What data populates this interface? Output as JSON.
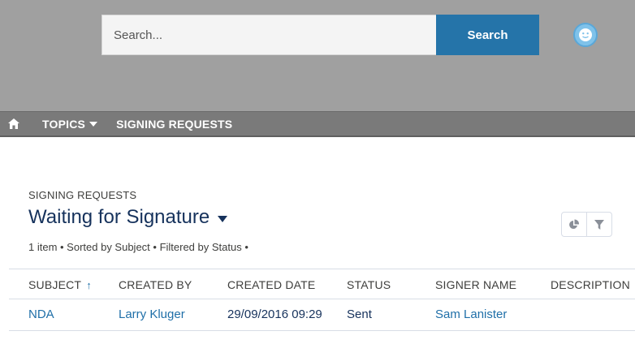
{
  "search": {
    "placeholder": "Search...",
    "button_label": "Search"
  },
  "nav": {
    "topics_label": "TOPICS",
    "signing_label": "SIGNING REQUESTS"
  },
  "list": {
    "object_label": "SIGNING REQUESTS",
    "title": "Waiting for Signature",
    "meta": "1 item • Sorted by Subject • Filtered by Status •"
  },
  "table": {
    "columns": [
      "SUBJECT",
      "CREATED BY",
      "CREATED DATE",
      "STATUS",
      "SIGNER NAME",
      "DESCRIPTION"
    ],
    "sort_indicator": "↑",
    "rows": [
      {
        "subject": "NDA",
        "created_by": "Larry Kluger",
        "created_date": "29/09/2016 09:29",
        "status": "Sent",
        "signer_name": "Sam Lanister",
        "description": ""
      }
    ]
  },
  "icons": {
    "home": "home-icon",
    "avatar": "smiley-avatar-icon",
    "chart": "pie-chart-icon",
    "filter": "filter-icon"
  },
  "colors": {
    "header_bg": "#a0a0a0",
    "nav_bg": "#7a7a7a",
    "accent": "#2574a9",
    "link": "#1f6fa8"
  }
}
